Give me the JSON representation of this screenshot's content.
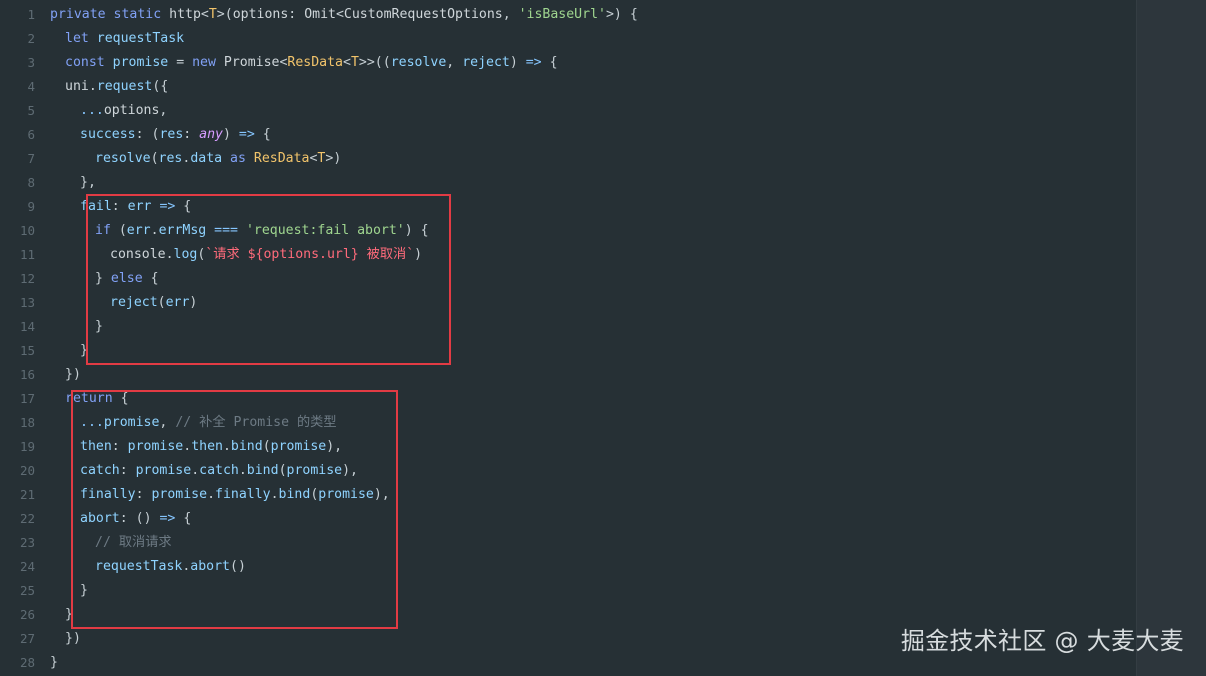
{
  "editor": {
    "watermark": "掘金技术社区 @ 大麦大麦",
    "lines": [
      {
        "n": "1",
        "indent": 0,
        "text": "private static http<T>(options: Omit<CustomRequestOptions, 'isBaseUrl'>) {"
      },
      {
        "n": "2",
        "indent": 1,
        "text": "let requestTask"
      },
      {
        "n": "3",
        "indent": 1,
        "text": "const promise = new Promise<ResData<T>>((resolve, reject) => {"
      },
      {
        "n": "4",
        "indent": 1,
        "text": "uni.request({"
      },
      {
        "n": "5",
        "indent": 2,
        "text": "...options,"
      },
      {
        "n": "6",
        "indent": 2,
        "text": "success: (res: any) => {"
      },
      {
        "n": "7",
        "indent": 3,
        "text": "resolve(res.data as ResData<T>)"
      },
      {
        "n": "8",
        "indent": 2,
        "text": "},"
      },
      {
        "n": "9",
        "indent": 2,
        "text": "fail: err => {"
      },
      {
        "n": "10",
        "indent": 3,
        "text": "if (err.errMsg === 'request:fail abort') {"
      },
      {
        "n": "11",
        "indent": 4,
        "text": "console.log(`请求 ${options.url} 被取消`)"
      },
      {
        "n": "12",
        "indent": 3,
        "text": "} else {"
      },
      {
        "n": "13",
        "indent": 4,
        "text": "reject(err)"
      },
      {
        "n": "14",
        "indent": 3,
        "text": "}"
      },
      {
        "n": "15",
        "indent": 2,
        "text": "}"
      },
      {
        "n": "16",
        "indent": 1,
        "text": "})"
      },
      {
        "n": "17",
        "indent": 1,
        "text": "return {"
      },
      {
        "n": "18",
        "indent": 2,
        "text": "...promise, // 补全 Promise 的类型"
      },
      {
        "n": "19",
        "indent": 2,
        "text": "then: promise.then.bind(promise),"
      },
      {
        "n": "20",
        "indent": 2,
        "text": "catch: promise.catch.bind(promise),"
      },
      {
        "n": "21",
        "indent": 2,
        "text": "finally: promise.finally.bind(promise),"
      },
      {
        "n": "22",
        "indent": 2,
        "text": "abort: () => {"
      },
      {
        "n": "23",
        "indent": 3,
        "text": "// 取消请求"
      },
      {
        "n": "24",
        "indent": 3,
        "text": "requestTask.abort()"
      },
      {
        "n": "25",
        "indent": 2,
        "text": "}"
      },
      {
        "n": "26",
        "indent": 1,
        "text": "}"
      },
      {
        "n": "27",
        "indent": 1,
        "text": "})"
      },
      {
        "n": "28",
        "indent": 0,
        "text": "}"
      }
    ]
  }
}
